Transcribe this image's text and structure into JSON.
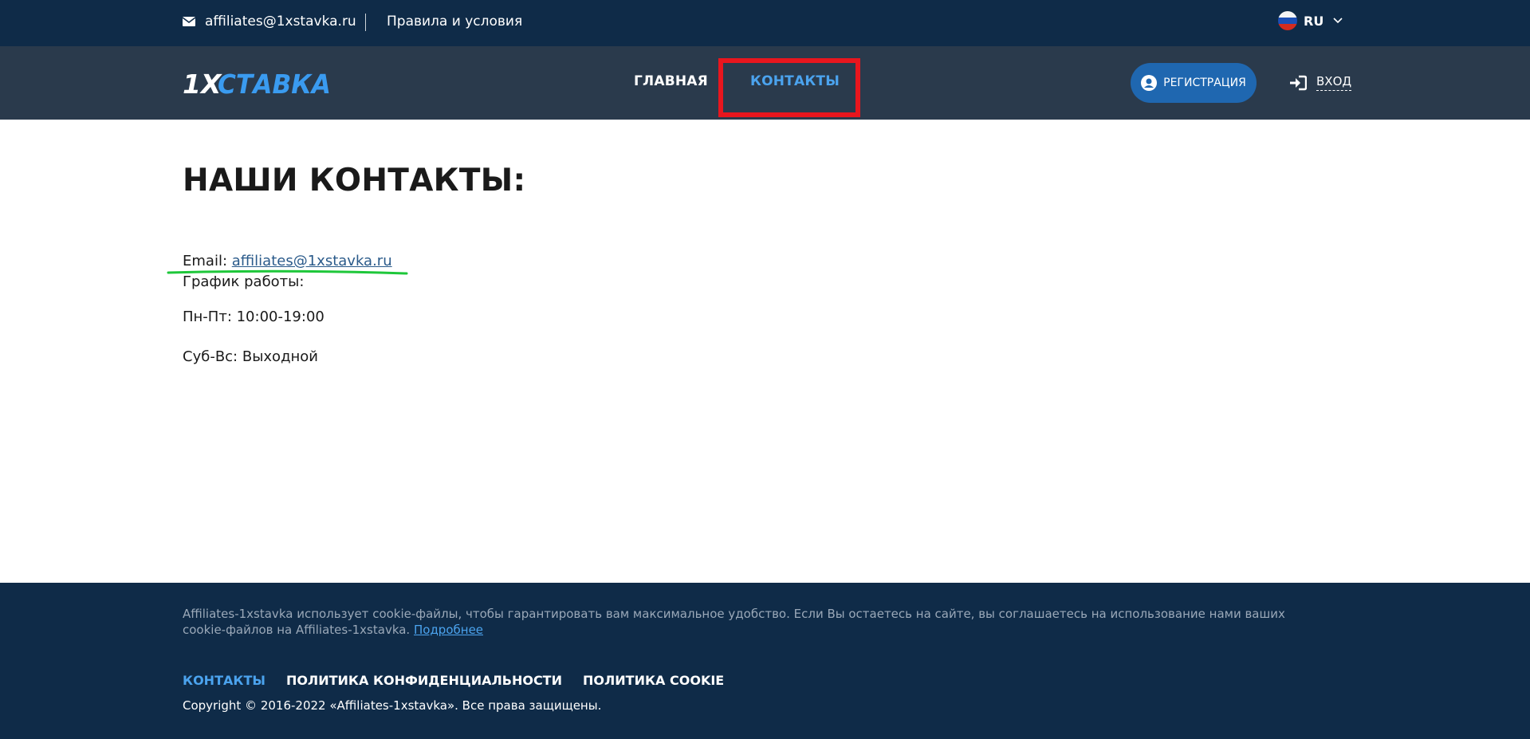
{
  "topbar": {
    "email": "affiliates@1xstavka.ru",
    "terms": "Правила и условия",
    "lang": "RU"
  },
  "navbar": {
    "logo_text": "1XСТАВКА",
    "home": "ГЛАВНАЯ",
    "contacts": "КОНТАКТЫ",
    "register": "РЕГИСТРАЦИЯ",
    "login": "ВХОД"
  },
  "main": {
    "title": "НАШИ КОНТАКТЫ:",
    "email_label": "Email:",
    "email_value": "affiliates@1xstavka.ru",
    "schedule_label": "График работы:",
    "weekdays": "Пн-Пт: 10:00-19:00",
    "weekend": "Суб-Вс: Выходной"
  },
  "footer": {
    "cookie_text": "Affiliates-1xstavka использует cookie-файлы, чтобы гарантировать вам максимальное удобство. Если Вы остаетесь на сайте, вы соглашаетесь на использование нами ваших cookie-файлов на Affiliates-1xstavka.",
    "cookie_more": "Подробнее",
    "links": [
      "КОНТАКТЫ",
      "ПОЛИТИКА КОНФИДЕНЦИАЛЬНОСТИ",
      "ПОЛИТИКА COOKIE"
    ],
    "copyright": "Copyright © 2016-2022 «Affiliates-1xstavka». Все права защищены."
  },
  "colors": {
    "topbar_bg": "#0f2b48",
    "navbar_bg": "#2a3a4c",
    "accent": "#4ba3ee",
    "register_btn": "#1f67b0",
    "highlight_box": "#e8161e",
    "annotation_line": "#1ec73a"
  },
  "icons": {
    "mail": "envelope-icon",
    "flag": "russia-flag-icon",
    "chevron": "chevron-down-icon",
    "user": "user-circle-icon",
    "login": "sign-in-icon"
  }
}
